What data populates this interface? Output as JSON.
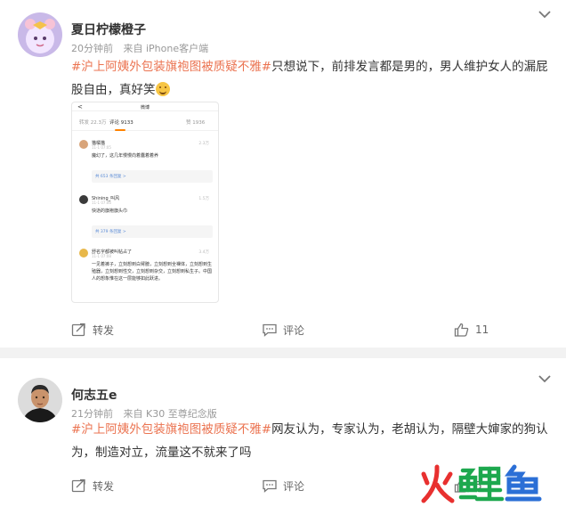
{
  "posts": [
    {
      "username": "夏日柠檬橙子",
      "time": "20分钟前",
      "source": "来自 iPhone客户端",
      "topic": "#沪上阿姨外包装旗袍图被质疑不雅#",
      "text": "只想说下，前排发言都是男的，男人维护女人的漏屁股自由，真好笑",
      "emoji_icon": "laughing-face-icon",
      "repost_label": "转发",
      "comment_label": "评论",
      "like_count": "11",
      "embedded_screenshot": {
        "back": "<",
        "title": "微博",
        "tabs": [
          "转发 22.3万",
          "评论 9133",
          "赞 1936"
        ],
        "comments": [
          {
            "name": "猫橘猫",
            "time": "11-1 07:05",
            "likes": "2.3万",
            "body": "魔幻了，这几年慢慢向着蠢着着养",
            "reply": "共 653 条回复 >"
          },
          {
            "name": "Shining_叫风",
            "time": "11-1 07:06",
            "likes": "1.5万",
            "body": "快逝的旗袍旗头巾",
            "reply": "共 379 条回复 >"
          },
          {
            "name": "舒名字都被叫帖占了",
            "time": "11-1 07:08",
            "likes": "3.4万",
            "body": "一见着裤子，立刻想到白臂膀，立刻想到全裸体，立刻想到生殖器，立刻想到性交，立刻想到杂交，立刻想到私生子。中国人的想象惟在这一层能够如此跃进。"
          }
        ]
      }
    },
    {
      "username": "何志五e",
      "time": "21分钟前",
      "source": "来自 K30 至尊纪念版",
      "topic": "#沪上阿姨外包装旗袍图被质疑不雅#",
      "text": "网友认为，专家认为，老胡认为，隔壁大婶家的狗认为，制造对立，流量这不就来了吗",
      "repost_label": "转发",
      "comment_label": "评论",
      "like_count": "5"
    }
  ],
  "watermark": {
    "text": "火鲤鱼",
    "colors": [
      "#e8302f",
      "#1da84e",
      "#2b6fd6"
    ]
  },
  "colors": {
    "topic": "#eb7350",
    "background": "#f2f2f2",
    "text": "#333333",
    "meta": "#999999"
  }
}
